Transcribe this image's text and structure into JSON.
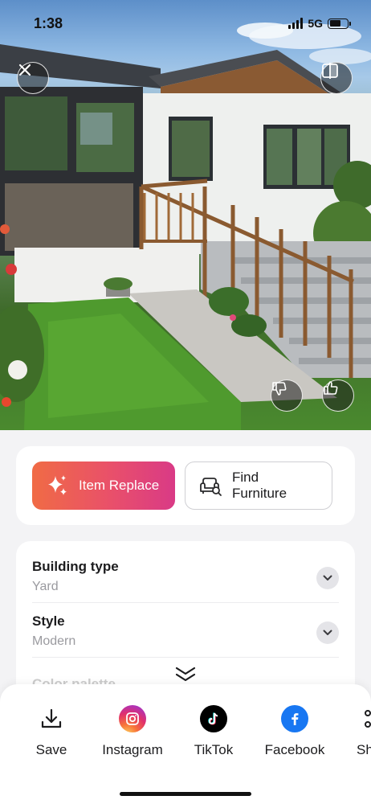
{
  "status": {
    "time": "1:38",
    "network": "5G",
    "battery_level": 0.65
  },
  "actions": {
    "item_replace_label": "Item Replace",
    "find_furniture_label": "Find\nFurniture"
  },
  "form": {
    "building_type": {
      "title": "Building type",
      "value": "Yard"
    },
    "style": {
      "title": "Style",
      "value": "Modern"
    },
    "color_palette": {
      "title": "Color palette"
    }
  },
  "share": {
    "items": [
      {
        "label": "Save",
        "icon": "download-icon"
      },
      {
        "label": "Instagram",
        "icon": "instagram-icon",
        "color": "#e1306c"
      },
      {
        "label": "TikTok",
        "icon": "tiktok-icon",
        "color": "#000000"
      },
      {
        "label": "Facebook",
        "icon": "facebook-icon",
        "color": "#1877f2"
      },
      {
        "label": "Sh",
        "icon": "share-icon"
      }
    ]
  },
  "colors": {
    "accent_gradient_start": "#f06b45",
    "accent_gradient_end": "#d93a86",
    "card_bg": "#ffffff",
    "page_bg": "#f3f3f5"
  }
}
